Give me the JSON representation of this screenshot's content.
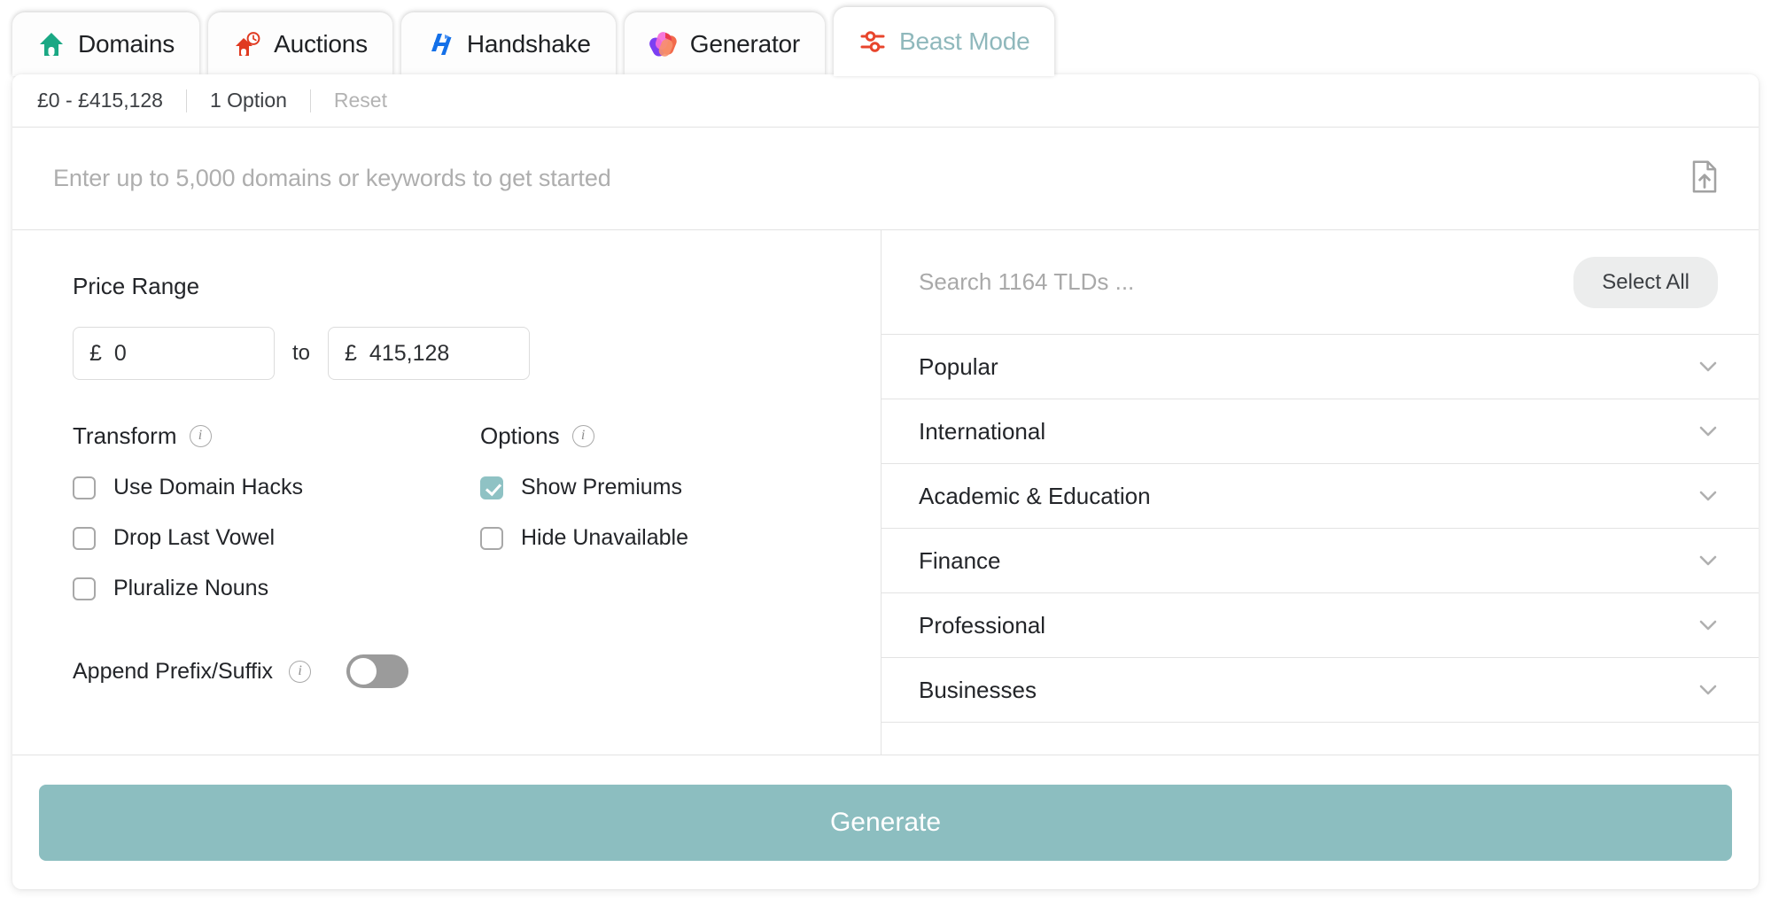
{
  "tabs": [
    {
      "label": "Domains",
      "icon": "house-icon",
      "active": false
    },
    {
      "label": "Auctions",
      "icon": "auction-clock-icon",
      "active": false
    },
    {
      "label": "Handshake",
      "icon": "handshake-logo-icon",
      "active": false
    },
    {
      "label": "Generator",
      "icon": "capsules-icon",
      "active": false
    },
    {
      "label": "Beast Mode",
      "icon": "sliders-icon",
      "active": true
    }
  ],
  "filter_bar": {
    "price_summary": "£0 - £415,128",
    "option_count": "1 Option",
    "reset_label": "Reset"
  },
  "keywords": {
    "placeholder": "Enter up to 5,000 domains or keywords to get started",
    "value": "",
    "upload_icon": "file-upload-icon"
  },
  "left_pane": {
    "price_range": {
      "title": "Price Range",
      "currency": "£",
      "min_value": "0",
      "max_value": "415,128",
      "to_label": "to"
    },
    "transform": {
      "title": "Transform",
      "info_icon": "info-icon",
      "items": [
        {
          "label": "Use Domain Hacks",
          "checked": false
        },
        {
          "label": "Drop Last Vowel",
          "checked": false
        },
        {
          "label": "Pluralize Nouns",
          "checked": false
        }
      ]
    },
    "options": {
      "title": "Options",
      "info_icon": "info-icon",
      "items": [
        {
          "label": "Show Premiums",
          "checked": true
        },
        {
          "label": "Hide Unavailable",
          "checked": false
        }
      ]
    },
    "append": {
      "label": "Append Prefix/Suffix",
      "info_icon": "info-icon",
      "enabled": false
    }
  },
  "right_pane": {
    "search_placeholder": "Search 1164 TLDs ...",
    "select_all_label": "Select All",
    "categories": [
      {
        "name": "Popular"
      },
      {
        "name": "International"
      },
      {
        "name": "Academic & Education"
      },
      {
        "name": "Finance"
      },
      {
        "name": "Professional"
      },
      {
        "name": "Businesses"
      }
    ]
  },
  "footer": {
    "generate_label": "Generate"
  },
  "colors": {
    "accent_teal": "#8cbec0",
    "checkbox_teal": "#8fc2c4",
    "active_tab_text": "#8fb8bc",
    "beast_icon_red": "#e8452c",
    "domains_icon_green": "#1aa884",
    "handshake_blue": "#1470e8"
  }
}
